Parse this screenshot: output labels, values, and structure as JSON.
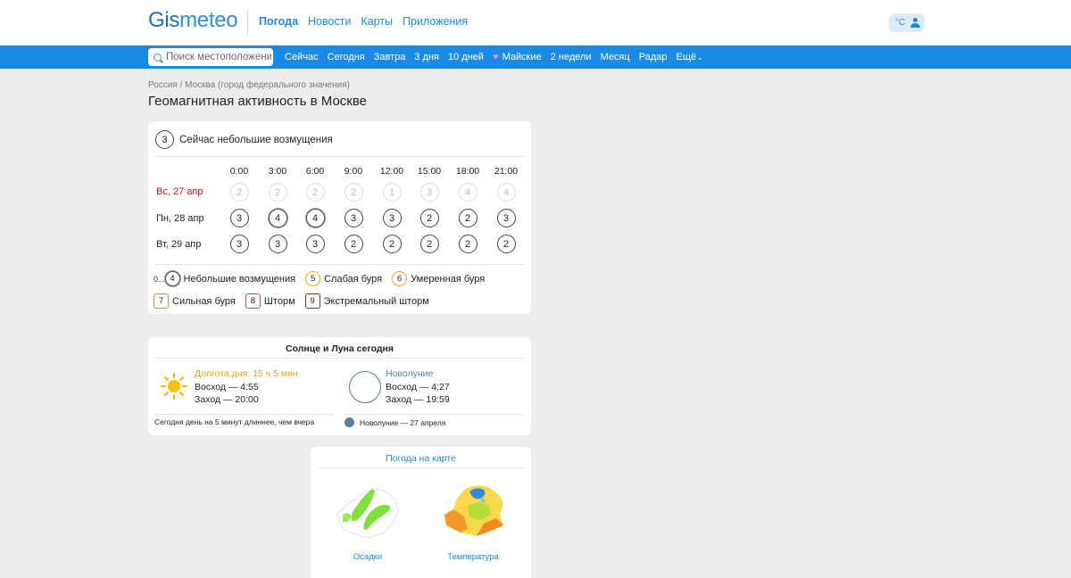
{
  "header": {
    "logo_g": "Gis",
    "logo_rest": "meteo",
    "nav": [
      "Погода",
      "Новости",
      "Карты",
      "Приложения"
    ],
    "unit": "°C"
  },
  "subbar": {
    "search_placeholder": "Поиск местоположения",
    "links": [
      "Сейчас",
      "Сегодня",
      "Завтра",
      "3 дня",
      "10 дней",
      "Майские",
      "2 недели",
      "Месяц",
      "Радар",
      "Ещё"
    ]
  },
  "breadcrumb": "Россия / Москва (город федерального значения)",
  "title": "Геомагнитная активность в Москве",
  "now": {
    "value": "3",
    "label": "Сейчас небольшие возмущения"
  },
  "table": {
    "hours": [
      "0:00",
      "3:00",
      "6:00",
      "9:00",
      "12:00",
      "15:00",
      "18:00",
      "21:00"
    ],
    "rows": [
      {
        "day": "Вс, 27 апр",
        "values": [
          "2",
          "2",
          "2",
          "2",
          "1",
          "3",
          "4",
          "4"
        ]
      },
      {
        "day": "Пн, 28 апр",
        "values": [
          "3",
          "4",
          "4",
          "3",
          "3",
          "2",
          "2",
          "3"
        ]
      },
      {
        "day": "Вт, 29 апр",
        "values": [
          "3",
          "3",
          "3",
          "2",
          "2",
          "2",
          "2",
          "2"
        ]
      }
    ]
  },
  "legend": {
    "zero": "0...",
    "items": [
      {
        "kp": "4",
        "label": "Небольшие возмущения"
      },
      {
        "kp": "5",
        "label": "Слабая буря"
      },
      {
        "kp": "6",
        "label": "Умеренная буря"
      },
      {
        "kp": "7",
        "label": "Сильная буря"
      },
      {
        "kp": "8",
        "label": "Шторм"
      },
      {
        "kp": "9",
        "label": "Экстремальный шторм"
      }
    ]
  },
  "sun_moon": {
    "title": "Солнце и Луна сегодня",
    "sun": {
      "daylight": "Долгота дня: 15 ч 5 мин",
      "rise": "Восход — 4:55",
      "set": "Заход — 20:00"
    },
    "moon": {
      "phase": "Новолуние",
      "rise": "Восход — 4:27",
      "set": "Заход — 19:59"
    },
    "footer_sun": "Сегодня день на 5 минут длиннее, чем вчера",
    "footer_moon": "Новолуние — 27 апреля"
  },
  "maps": {
    "title": "Погода на карте",
    "items": [
      "Осадки",
      "Температура"
    ]
  },
  "colors": {
    "accent": "#1a8ae5",
    "today_red": "#c41414",
    "sun": "#e4a315",
    "moon": "#5b7fa6"
  }
}
